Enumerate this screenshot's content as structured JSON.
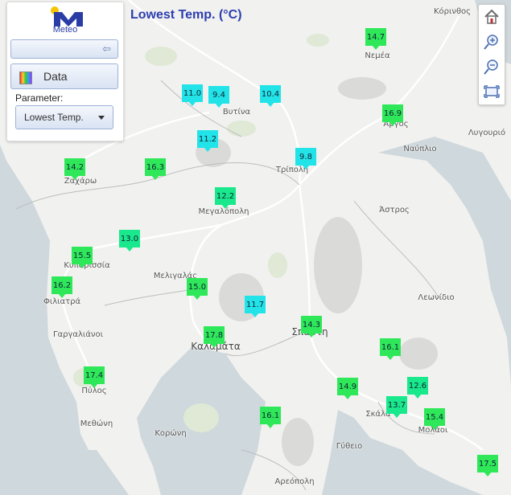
{
  "header": {
    "title": "Lowest Temp. (°C)"
  },
  "panel": {
    "logo_text": "Meteo",
    "data_label": "Data",
    "parameter_label": "Parameter:",
    "parameter_selected": "Lowest Temp."
  },
  "colors": {
    "title": "#2b3fb0",
    "cool": "#22e4e8",
    "mid": "#19e98c",
    "warm": "#2ee85a"
  },
  "places": [
    {
      "name": "Κόρινθος",
      "cls": "big"
    },
    {
      "name": "Νεμέα",
      "cls": ""
    },
    {
      "name": "Βυτίνα",
      "cls": ""
    },
    {
      "name": "Άργος",
      "cls": "big"
    },
    {
      "name": "Λυγουριό",
      "cls": ""
    },
    {
      "name": "Ναύπλιο",
      "cls": ""
    },
    {
      "name": "Τρίπολη",
      "cls": "big"
    },
    {
      "name": "Ζαχάρω",
      "cls": ""
    },
    {
      "name": "Μεγαλόπολη",
      "cls": ""
    },
    {
      "name": "Άστρος",
      "cls": ""
    },
    {
      "name": "Κυπαρισσία",
      "cls": ""
    },
    {
      "name": "Μελιγαλάς",
      "cls": ""
    },
    {
      "name": "Φιλιατρά",
      "cls": ""
    },
    {
      "name": "Λεωνίδιο",
      "cls": ""
    },
    {
      "name": "Γαργαλιάνοι",
      "cls": ""
    },
    {
      "name": "Σπάρτη",
      "cls": "big"
    },
    {
      "name": "Καλαμάτα",
      "cls": "big"
    },
    {
      "name": "Πύλος",
      "cls": ""
    },
    {
      "name": "Σκάλα",
      "cls": ""
    },
    {
      "name": "Μεθώνη",
      "cls": ""
    },
    {
      "name": "Μολάοι",
      "cls": ""
    },
    {
      "name": "Κορώνη",
      "cls": ""
    },
    {
      "name": "Γύθειο",
      "cls": ""
    },
    {
      "name": "Αρεόπολη",
      "cls": ""
    }
  ],
  "stations": [
    {
      "label": "14.7",
      "color": "#2ee85a"
    },
    {
      "label": "11.0",
      "color": "#22e4e8"
    },
    {
      "label": "9.4",
      "color": "#22e4e8"
    },
    {
      "label": "10.4",
      "color": "#22e4e8"
    },
    {
      "label": "16.9",
      "color": "#2ee85a"
    },
    {
      "label": "11.2",
      "color": "#22e4e8"
    },
    {
      "label": "9.8",
      "color": "#22e4e8"
    },
    {
      "label": "14.2",
      "color": "#2ee85a"
    },
    {
      "label": "16.3",
      "color": "#2ee85a"
    },
    {
      "label": "12.2",
      "color": "#19e98c"
    },
    {
      "label": "13.0",
      "color": "#19e98c"
    },
    {
      "label": "15.5",
      "color": "#2ee85a"
    },
    {
      "label": "16.2",
      "color": "#2ee85a"
    },
    {
      "label": "15.0",
      "color": "#2ee85a"
    },
    {
      "label": "11.7",
      "color": "#22e4e8"
    },
    {
      "label": "14.3",
      "color": "#2ee85a"
    },
    {
      "label": "16.1",
      "color": "#2ee85a"
    },
    {
      "label": "17.8",
      "color": "#2ee85a"
    },
    {
      "label": "17.4",
      "color": "#2ee85a"
    },
    {
      "label": "14.9",
      "color": "#2ee85a"
    },
    {
      "label": "12.6",
      "color": "#19e98c"
    },
    {
      "label": "13.7",
      "color": "#19e98c"
    },
    {
      "label": "15.4",
      "color": "#2ee85a"
    },
    {
      "label": "16.1",
      "color": "#2ee85a"
    },
    {
      "label": "17.5",
      "color": "#2ee85a"
    }
  ]
}
